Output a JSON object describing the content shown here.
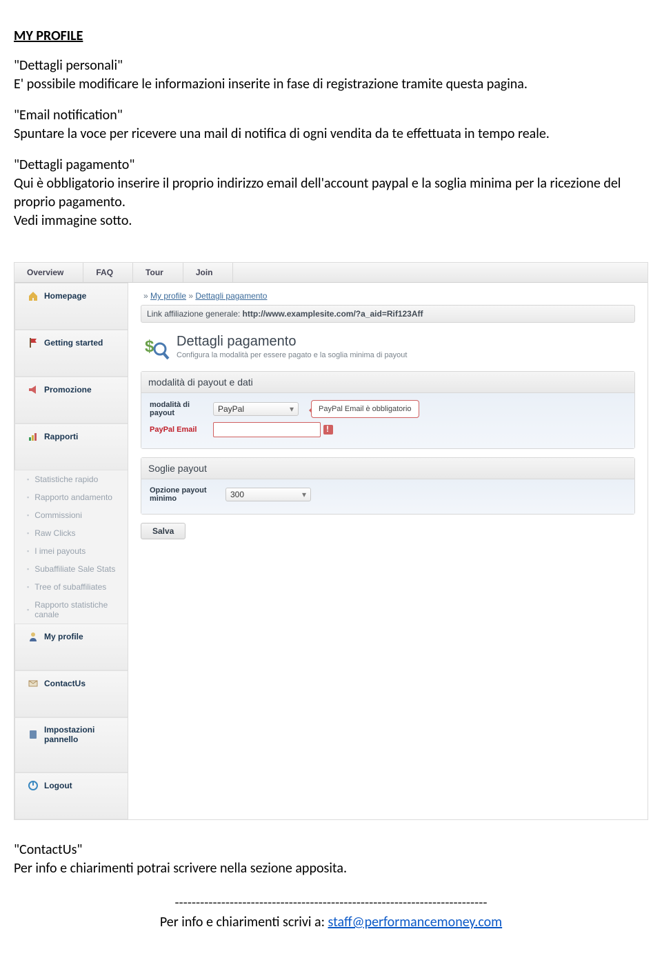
{
  "doc": {
    "heading": "MY PROFILE",
    "p1_title": "Dettagli personali",
    "p1_body": "E' possibile modificare le informazioni inserite in fase di registrazione tramite questa pagina.",
    "p2_title": "Email notification",
    "p2_body": "Spuntare la voce per ricevere una mail di notifica di ogni vendita da te effettuata in tempo reale.",
    "p3_title": "Dettagli pagamento",
    "p3_body": "Qui è obbligatorio inserire il proprio indirizzo email dell'account paypal e la soglia minima per la ricezione del proprio pagamento.",
    "p3_body2": "Vedi immagine sotto.",
    "p4_title": "ContactUs",
    "p4_body": "Per info e chiarimenti potrai scrivere nella sezione apposita.",
    "divider": "--------------------------------------------------------------------------",
    "footer_text": "Per info e chiarimenti scrivi a: ",
    "footer_email": "staff@performancemoney.com"
  },
  "app": {
    "topnav": [
      "Overview",
      "FAQ",
      "Tour",
      "Join"
    ],
    "sidebar": {
      "homepage": "Homepage",
      "getting_started": "Getting started",
      "promozione": "Promozione",
      "rapporti": "Rapporti",
      "subs": [
        "Statistiche rapido",
        "Rapporto andamento",
        "Commissioni",
        "Raw Clicks",
        "I imei payouts",
        "Subaffiliate Sale Stats",
        "Tree of subaffiliates",
        "Rapporto statistiche canale"
      ],
      "my_profile": "My profile",
      "contact": "ContactUs",
      "impostazioni": "Impostazioni pannello",
      "logout": "Logout"
    },
    "crumb_prefix": "»  ",
    "crumb1": "My profile",
    "crumb_sep": "  »  ",
    "crumb2": "Dettagli pagamento",
    "link_label": "Link affiliazione generale: ",
    "link_value": "http://www.examplesite.com/?a_aid=Rif123Aff",
    "hero_title": "Dettagli pagamento",
    "hero_sub": "Configura la modalità per essere pagato e la soglia minima di payout",
    "panel1_title": "modalità di payout e dati",
    "field1_label": "modalità di payout",
    "field1_value": "PayPal",
    "field2_label": "PayPal Email",
    "callout_text": "PayPal Email è obbligatorio",
    "panel2_title": "Soglie payout",
    "field3_label": "Opzione payout minimo",
    "field3_value": "300",
    "save": "Salva"
  }
}
